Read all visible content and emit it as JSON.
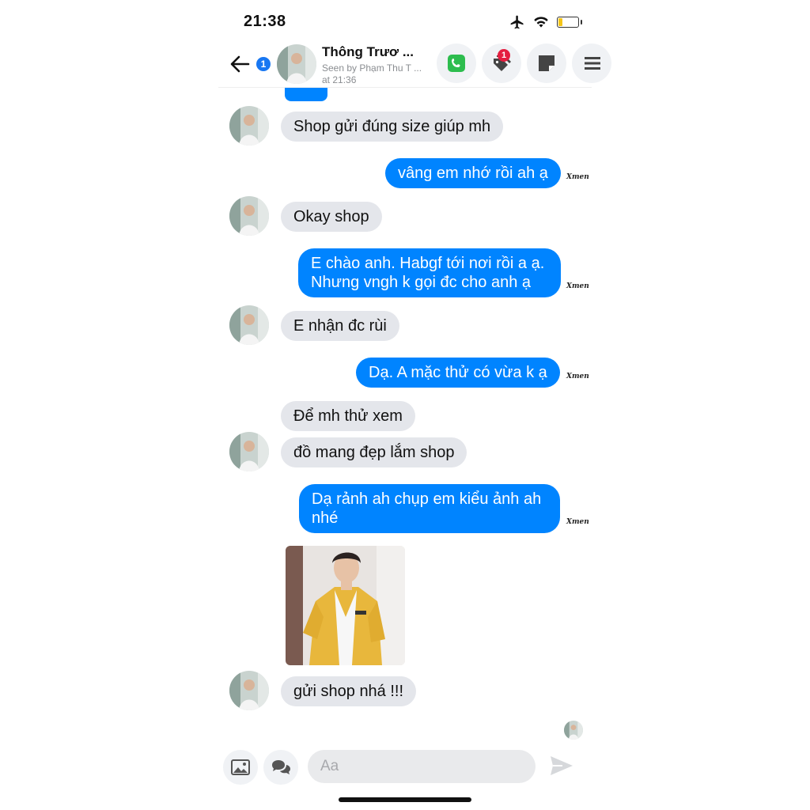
{
  "status_bar": {
    "time": "21:38"
  },
  "header": {
    "unread_count": "1",
    "contact_name": "Thông Trươ ...",
    "seen_line1": "Seen by Phạm Thu T ...",
    "seen_line2": "at 21:36",
    "tag_badge_count": "1",
    "icons": [
      "back-arrow-icon",
      "phone-icon",
      "tags-icon",
      "note-icon",
      "menu-icon"
    ]
  },
  "messages": [
    {
      "side": "in",
      "text": "Shop gửi đúng size giúp mh"
    },
    {
      "side": "out",
      "text": "vâng em nhớ rồi ah ạ"
    },
    {
      "side": "in",
      "text": "Okay shop"
    },
    {
      "side": "out",
      "line1": "E chào anh. Habgf tới nơi rồi a ạ.",
      "line2": "Nhưng vngh k gọi đc cho anh ạ"
    },
    {
      "side": "in",
      "text": "E nhận đc rùi"
    },
    {
      "side": "out",
      "text": "Dạ. A mặc thử có vừa k ạ"
    },
    {
      "side": "in",
      "text": "Để mh thử xem"
    },
    {
      "side": "in",
      "text": "đồ mang đẹp lắm shop"
    },
    {
      "side": "out",
      "line1": "Dạ rảnh ah chụp em kiểu ảnh ah",
      "line2": "nhé"
    },
    {
      "side": "in",
      "type": "photo"
    },
    {
      "side": "in",
      "text": "gửi shop nhá !!!"
    }
  ],
  "watermark": "Xmen",
  "composer": {
    "placeholder": "Aa"
  },
  "colors": {
    "outgoing": "#0084ff",
    "incoming": "#e4e6eb",
    "badge": "#e41e3f",
    "accent": "#1877f2",
    "call": "#2dbd4e"
  }
}
